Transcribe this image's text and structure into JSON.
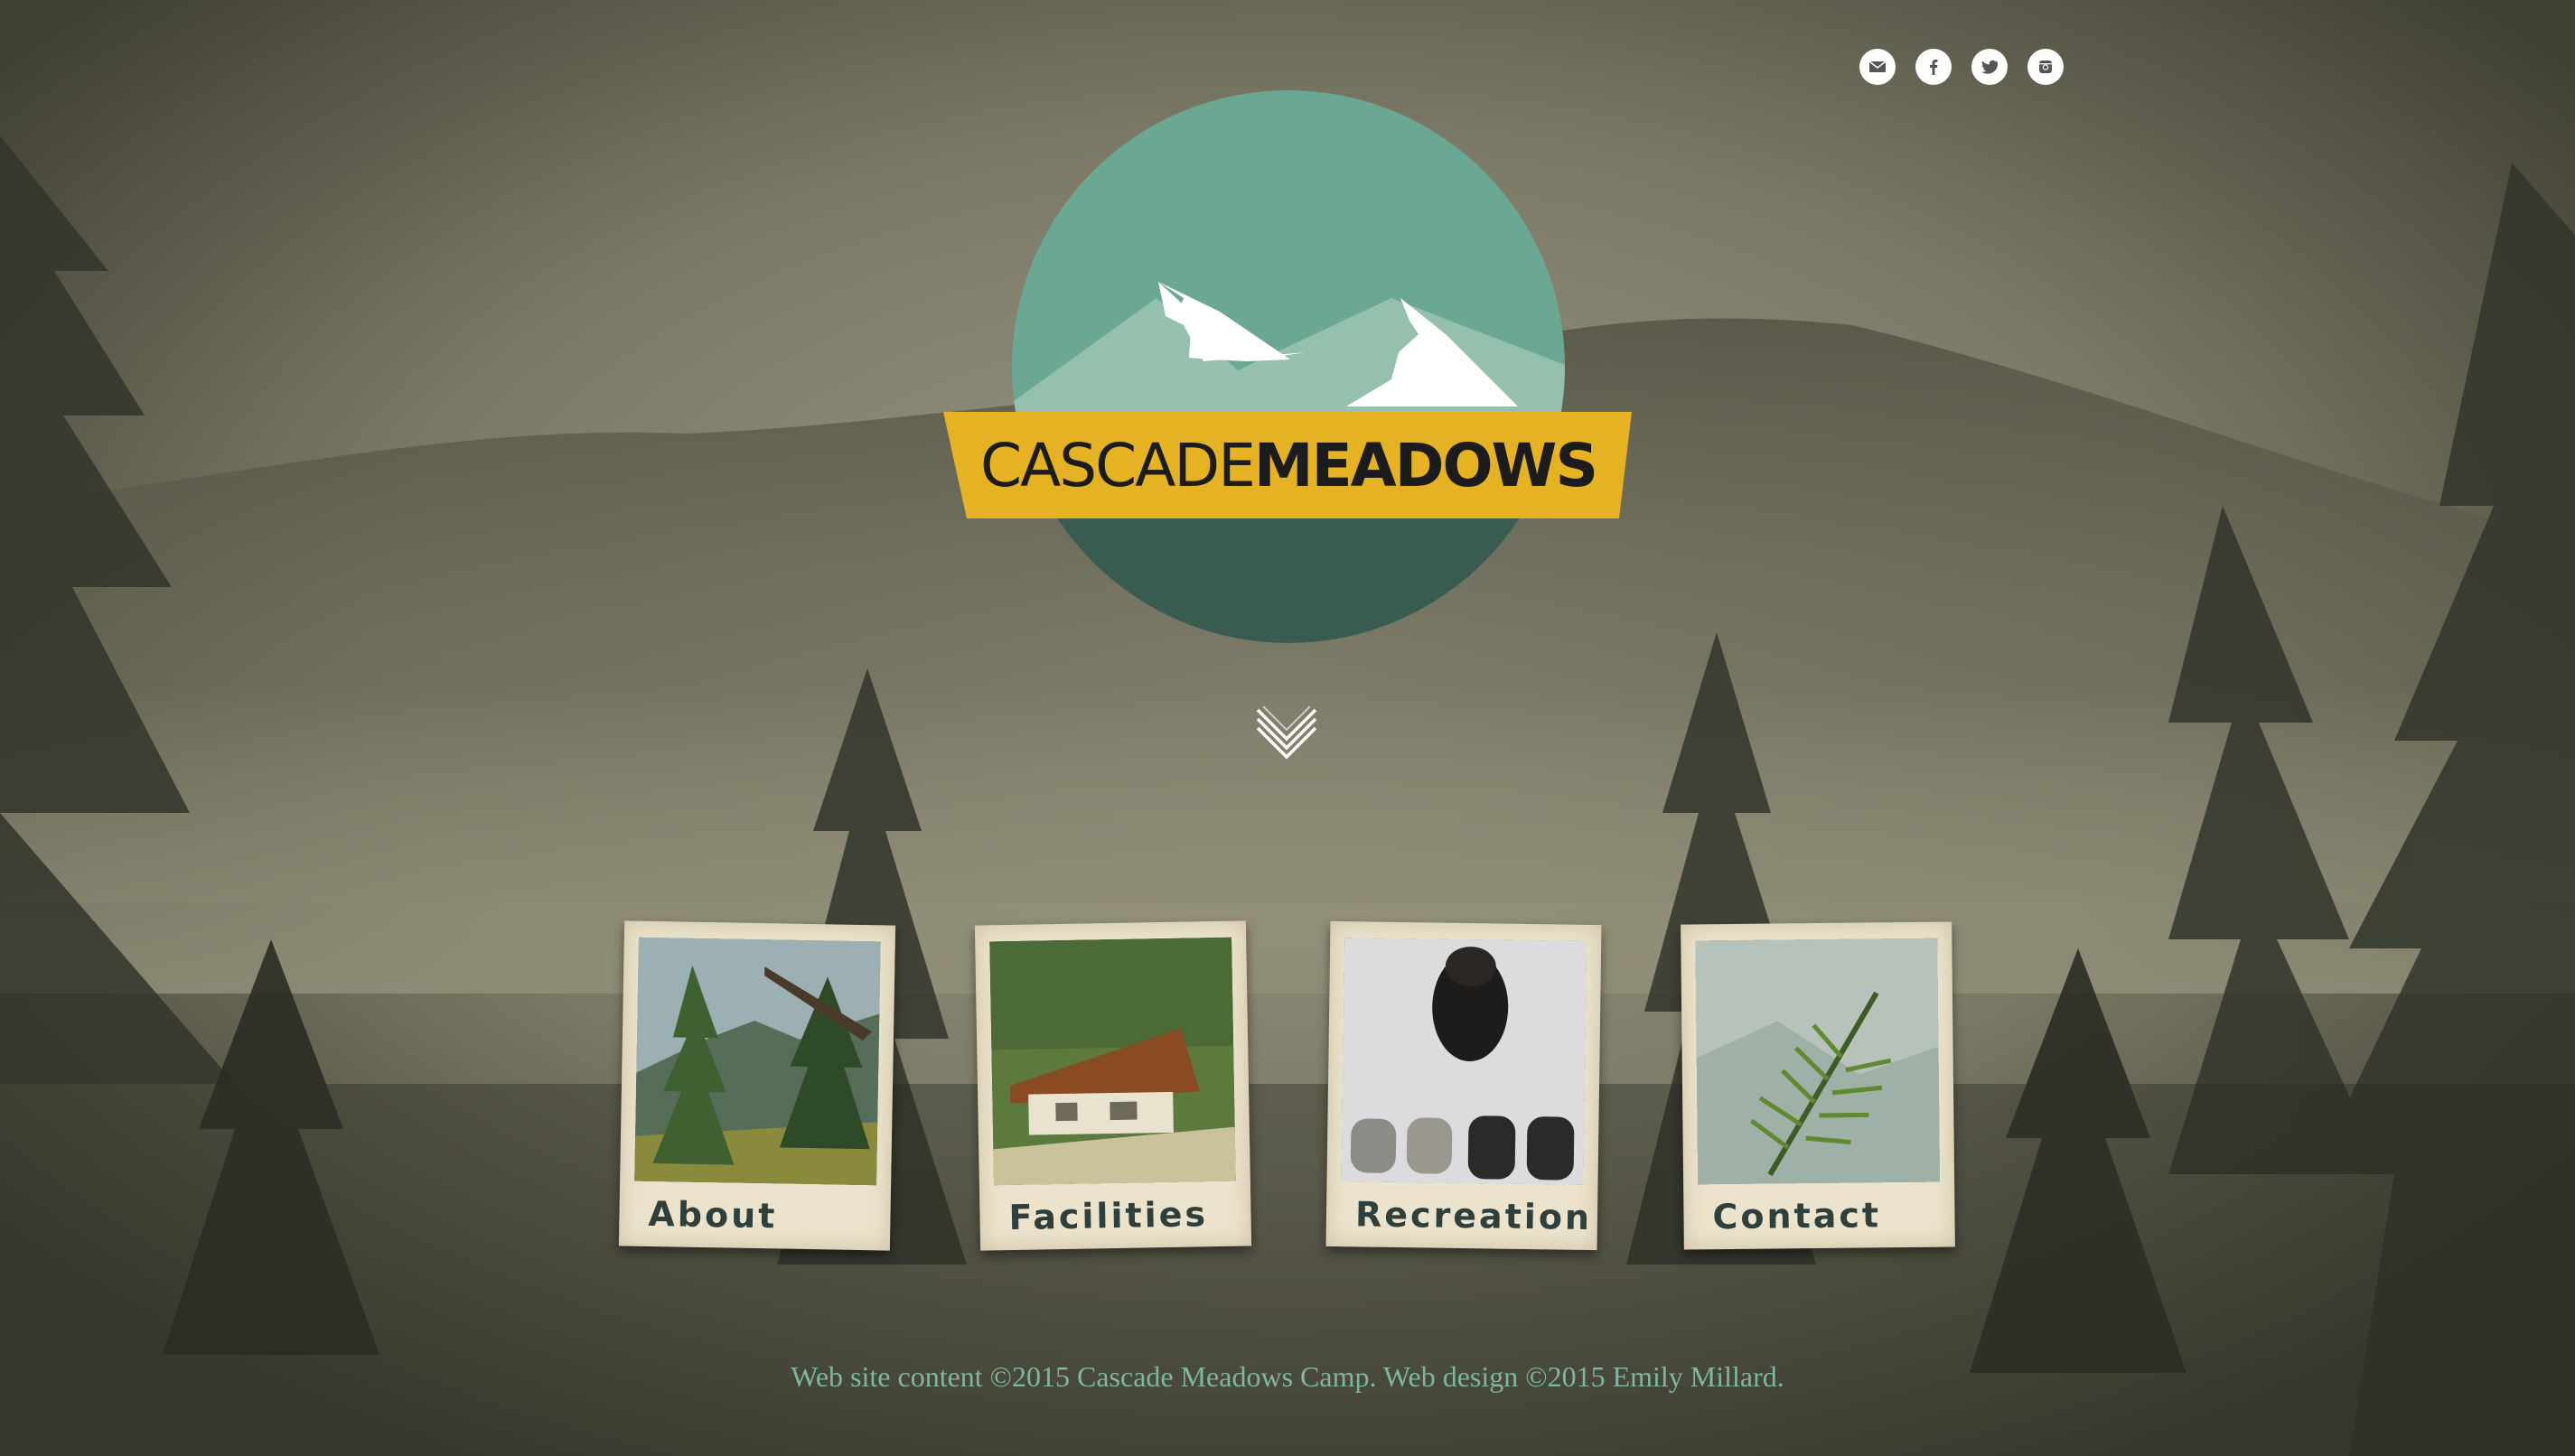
{
  "social": [
    {
      "name": "email-icon"
    },
    {
      "name": "facebook-icon"
    },
    {
      "name": "twitter-icon"
    },
    {
      "name": "instagram-icon"
    }
  ],
  "logo": {
    "brand_light": "CASCADE",
    "brand_bold": "MEADOWS",
    "colors": {
      "circle": "#6aa893",
      "circle_dark": "#3a5c50",
      "mountain_pale": "#95c0ae",
      "snow": "#ffffff",
      "banner": "#e5b223"
    }
  },
  "nav": {
    "cards": [
      {
        "id": "about",
        "label": "About"
      },
      {
        "id": "facilities",
        "label": "Facilities"
      },
      {
        "id": "recreation",
        "label": "Recreation"
      },
      {
        "id": "contact",
        "label": "Contact"
      }
    ]
  },
  "footer": {
    "text": "Web site content ©2015 Cascade Meadows Camp. Web design ©2015 Emily Millard."
  },
  "colors": {
    "fog": "#8d8a74",
    "footer_text": "#7fb6a2",
    "card_paper": "#ebe3cc",
    "card_label": "#2f3f3c"
  }
}
